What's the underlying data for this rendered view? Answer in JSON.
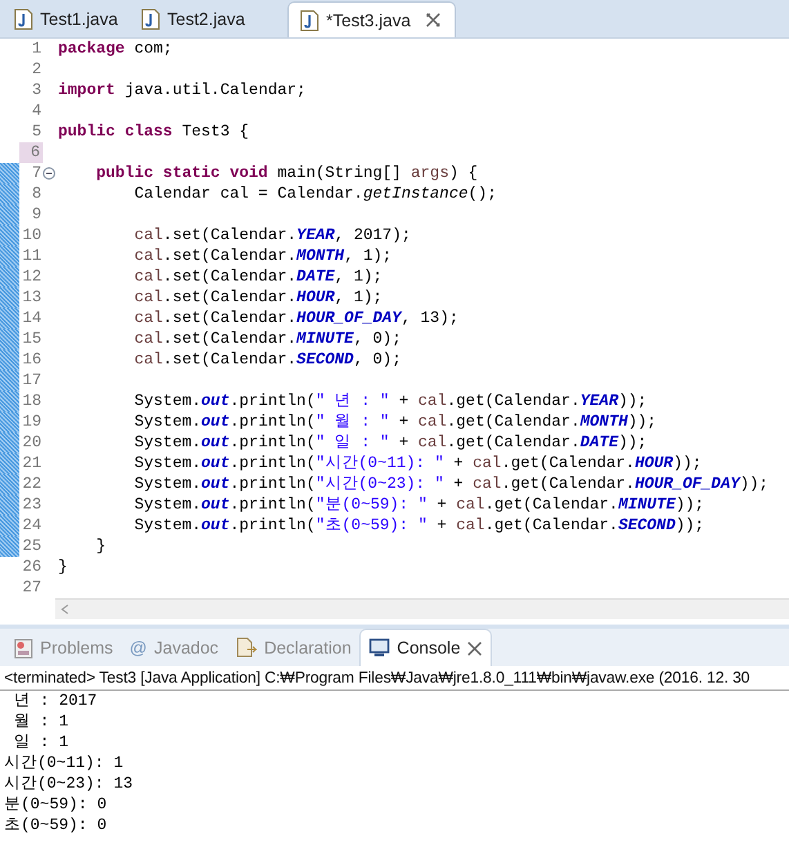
{
  "editor_tabs": [
    {
      "label": "Test1.java",
      "selected": false
    },
    {
      "label": "Test2.java",
      "selected": false
    },
    {
      "label": "*Test3.java",
      "selected": true
    }
  ],
  "code_lines": [
    {
      "number": "1",
      "changed": false,
      "current": false,
      "foldable": false,
      "tokens": [
        {
          "kind": "kw",
          "t": "package"
        },
        {
          "kind": "plain",
          "t": " com;"
        }
      ]
    },
    {
      "number": "2",
      "changed": false,
      "current": false,
      "foldable": false
    },
    {
      "number": "3",
      "changed": false,
      "current": false,
      "foldable": false,
      "tokens": [
        {
          "kind": "kw",
          "t": "import"
        },
        {
          "kind": "plain",
          "t": " java.util.Calendar;"
        }
      ]
    },
    {
      "number": "4",
      "changed": false,
      "current": false,
      "foldable": false
    },
    {
      "number": "5",
      "changed": false,
      "current": false,
      "foldable": false,
      "tokens": [
        {
          "kind": "kw",
          "t": "public"
        },
        {
          "kind": "kw",
          "t": " class"
        },
        {
          "kind": "plain",
          "t": " Test3 {"
        }
      ]
    },
    {
      "number": "6",
      "changed": false,
      "current": true,
      "foldable": false
    },
    {
      "number": "7",
      "changed": true,
      "current": false,
      "foldable": true,
      "tokens": [
        {
          "kind": "kw",
          "t": "    public"
        },
        {
          "kind": "kw",
          "t": " static"
        },
        {
          "kind": "kw",
          "t": " void"
        },
        {
          "kind": "plain",
          "t": " main(String[] "
        },
        {
          "kind": "var",
          "t": "args"
        },
        {
          "kind": "plain",
          "t": ") {"
        }
      ]
    },
    {
      "number": "8",
      "changed": true,
      "current": false,
      "foldable": false,
      "tokens": [
        {
          "kind": "plain",
          "t": "        Calendar cal = Calendar."
        },
        {
          "kind": "method",
          "t": "getInstance"
        },
        {
          "kind": "plain",
          "t": "();"
        }
      ]
    },
    {
      "number": "9",
      "changed": true,
      "current": false,
      "foldable": false
    },
    {
      "number": "10",
      "changed": true,
      "current": false,
      "foldable": false,
      "tokens": [
        {
          "kind": "var",
          "t": "        cal"
        },
        {
          "kind": "plain",
          "t": ".set(Calendar."
        },
        {
          "kind": "field",
          "t": "YEAR"
        },
        {
          "kind": "plain",
          "t": ", 2017);"
        }
      ]
    },
    {
      "number": "11",
      "changed": true,
      "current": false,
      "foldable": false,
      "tokens": [
        {
          "kind": "var",
          "t": "        cal"
        },
        {
          "kind": "plain",
          "t": ".set(Calendar."
        },
        {
          "kind": "field",
          "t": "MONTH"
        },
        {
          "kind": "plain",
          "t": ", 1);"
        }
      ]
    },
    {
      "number": "12",
      "changed": true,
      "current": false,
      "foldable": false,
      "tokens": [
        {
          "kind": "var",
          "t": "        cal"
        },
        {
          "kind": "plain",
          "t": ".set(Calendar."
        },
        {
          "kind": "field",
          "t": "DATE"
        },
        {
          "kind": "plain",
          "t": ", 1);"
        }
      ]
    },
    {
      "number": "13",
      "changed": true,
      "current": false,
      "foldable": false,
      "tokens": [
        {
          "kind": "var",
          "t": "        cal"
        },
        {
          "kind": "plain",
          "t": ".set(Calendar."
        },
        {
          "kind": "field",
          "t": "HOUR"
        },
        {
          "kind": "plain",
          "t": ", 1);"
        }
      ]
    },
    {
      "number": "14",
      "changed": true,
      "current": false,
      "foldable": false,
      "tokens": [
        {
          "kind": "var",
          "t": "        cal"
        },
        {
          "kind": "plain",
          "t": ".set(Calendar."
        },
        {
          "kind": "field",
          "t": "HOUR_OF_DAY"
        },
        {
          "kind": "plain",
          "t": ", 13);"
        }
      ]
    },
    {
      "number": "15",
      "changed": true,
      "current": false,
      "foldable": false,
      "tokens": [
        {
          "kind": "var",
          "t": "        cal"
        },
        {
          "kind": "plain",
          "t": ".set(Calendar."
        },
        {
          "kind": "field",
          "t": "MINUTE"
        },
        {
          "kind": "plain",
          "t": ", 0);"
        }
      ]
    },
    {
      "number": "16",
      "changed": true,
      "current": false,
      "foldable": false,
      "tokens": [
        {
          "kind": "var",
          "t": "        cal"
        },
        {
          "kind": "plain",
          "t": ".set(Calendar."
        },
        {
          "kind": "field",
          "t": "SECOND"
        },
        {
          "kind": "plain",
          "t": ", 0);"
        }
      ]
    },
    {
      "number": "17",
      "changed": true,
      "current": false,
      "foldable": false
    },
    {
      "number": "18",
      "changed": true,
      "current": false,
      "foldable": false,
      "tokens": [
        {
          "kind": "plain",
          "t": "        System."
        },
        {
          "kind": "field",
          "t": "out"
        },
        {
          "kind": "plain",
          "t": ".println("
        },
        {
          "kind": "str",
          "t": "\" 년 : \""
        },
        {
          "kind": "plain",
          "t": " + "
        },
        {
          "kind": "var",
          "t": "cal"
        },
        {
          "kind": "plain",
          "t": ".get(Calendar."
        },
        {
          "kind": "field",
          "t": "YEAR"
        },
        {
          "kind": "plain",
          "t": "));"
        }
      ]
    },
    {
      "number": "19",
      "changed": true,
      "current": false,
      "foldable": false,
      "tokens": [
        {
          "kind": "plain",
          "t": "        System."
        },
        {
          "kind": "field",
          "t": "out"
        },
        {
          "kind": "plain",
          "t": ".println("
        },
        {
          "kind": "str",
          "t": "\" 월 : \""
        },
        {
          "kind": "plain",
          "t": " + "
        },
        {
          "kind": "var",
          "t": "cal"
        },
        {
          "kind": "plain",
          "t": ".get(Calendar."
        },
        {
          "kind": "field",
          "t": "MONTH"
        },
        {
          "kind": "plain",
          "t": "));"
        }
      ]
    },
    {
      "number": "20",
      "changed": true,
      "current": false,
      "foldable": false,
      "tokens": [
        {
          "kind": "plain",
          "t": "        System."
        },
        {
          "kind": "field",
          "t": "out"
        },
        {
          "kind": "plain",
          "t": ".println("
        },
        {
          "kind": "str",
          "t": "\" 일 : \""
        },
        {
          "kind": "plain",
          "t": " + "
        },
        {
          "kind": "var",
          "t": "cal"
        },
        {
          "kind": "plain",
          "t": ".get(Calendar."
        },
        {
          "kind": "field",
          "t": "DATE"
        },
        {
          "kind": "plain",
          "t": "));"
        }
      ]
    },
    {
      "number": "21",
      "changed": true,
      "current": false,
      "foldable": false,
      "tokens": [
        {
          "kind": "plain",
          "t": "        System."
        },
        {
          "kind": "field",
          "t": "out"
        },
        {
          "kind": "plain",
          "t": ".println("
        },
        {
          "kind": "str",
          "t": "\"시간(0~11): \""
        },
        {
          "kind": "plain",
          "t": " + "
        },
        {
          "kind": "var",
          "t": "cal"
        },
        {
          "kind": "plain",
          "t": ".get(Calendar."
        },
        {
          "kind": "field",
          "t": "HOUR"
        },
        {
          "kind": "plain",
          "t": "));"
        }
      ]
    },
    {
      "number": "22",
      "changed": true,
      "current": false,
      "foldable": false,
      "tokens": [
        {
          "kind": "plain",
          "t": "        System."
        },
        {
          "kind": "field",
          "t": "out"
        },
        {
          "kind": "plain",
          "t": ".println("
        },
        {
          "kind": "str",
          "t": "\"시간(0~23): \""
        },
        {
          "kind": "plain",
          "t": " + "
        },
        {
          "kind": "var",
          "t": "cal"
        },
        {
          "kind": "plain",
          "t": ".get(Calendar."
        },
        {
          "kind": "field",
          "t": "HOUR_OF_DAY"
        },
        {
          "kind": "plain",
          "t": "));"
        }
      ]
    },
    {
      "number": "23",
      "changed": true,
      "current": false,
      "foldable": false,
      "tokens": [
        {
          "kind": "plain",
          "t": "        System."
        },
        {
          "kind": "field",
          "t": "out"
        },
        {
          "kind": "plain",
          "t": ".println("
        },
        {
          "kind": "str",
          "t": "\"분(0~59): \""
        },
        {
          "kind": "plain",
          "t": " + "
        },
        {
          "kind": "var",
          "t": "cal"
        },
        {
          "kind": "plain",
          "t": ".get(Calendar."
        },
        {
          "kind": "field",
          "t": "MINUTE"
        },
        {
          "kind": "plain",
          "t": "));"
        }
      ]
    },
    {
      "number": "24",
      "changed": true,
      "current": false,
      "foldable": false,
      "tokens": [
        {
          "kind": "plain",
          "t": "        System."
        },
        {
          "kind": "field",
          "t": "out"
        },
        {
          "kind": "plain",
          "t": ".println("
        },
        {
          "kind": "str",
          "t": "\"초(0~59): \""
        },
        {
          "kind": "plain",
          "t": " + "
        },
        {
          "kind": "var",
          "t": "cal"
        },
        {
          "kind": "plain",
          "t": ".get(Calendar."
        },
        {
          "kind": "field",
          "t": "SECOND"
        },
        {
          "kind": "plain",
          "t": "));"
        }
      ]
    },
    {
      "number": "25",
      "changed": true,
      "current": false,
      "foldable": false,
      "tokens": [
        {
          "kind": "plain",
          "t": "    }"
        }
      ]
    },
    {
      "number": "26",
      "changed": false,
      "current": false,
      "foldable": false,
      "tokens": [
        {
          "kind": "plain",
          "t": "}"
        }
      ]
    },
    {
      "number": "27",
      "changed": false,
      "current": false,
      "foldable": false
    }
  ],
  "view_tabs": [
    {
      "kind": "problems",
      "label": "Problems",
      "selected": false
    },
    {
      "kind": "javadoc",
      "label": "Javadoc",
      "icon_char": "@",
      "selected": false
    },
    {
      "kind": "declaration",
      "label": "Declaration",
      "selected": false
    },
    {
      "kind": "console",
      "label": "Console",
      "selected": true
    }
  ],
  "console": {
    "header": "<terminated> Test3 [Java Application] C:₩Program Files₩Java₩jre1.8.0_111₩bin₩javaw.exe (2016. 12. 30",
    "output": [
      " 년 : 2017",
      " 월 : 1",
      " 일 : 1",
      "시간(0~11): 1",
      "시간(0~23): 13",
      "분(0~59): 0",
      "초(0~59): 0"
    ]
  }
}
